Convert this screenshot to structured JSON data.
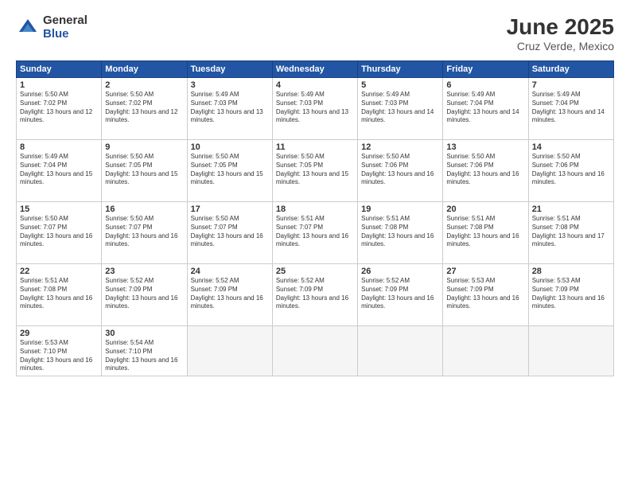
{
  "logo": {
    "general": "General",
    "blue": "Blue"
  },
  "title": "June 2025",
  "location": "Cruz Verde, Mexico",
  "days_of_week": [
    "Sunday",
    "Monday",
    "Tuesday",
    "Wednesday",
    "Thursday",
    "Friday",
    "Saturday"
  ],
  "weeks": [
    [
      {
        "day": 1,
        "sunrise": "5:50 AM",
        "sunset": "7:02 PM",
        "daylight": "13 hours and 12 minutes."
      },
      {
        "day": 2,
        "sunrise": "5:50 AM",
        "sunset": "7:02 PM",
        "daylight": "13 hours and 12 minutes."
      },
      {
        "day": 3,
        "sunrise": "5:49 AM",
        "sunset": "7:03 PM",
        "daylight": "13 hours and 13 minutes."
      },
      {
        "day": 4,
        "sunrise": "5:49 AM",
        "sunset": "7:03 PM",
        "daylight": "13 hours and 13 minutes."
      },
      {
        "day": 5,
        "sunrise": "5:49 AM",
        "sunset": "7:03 PM",
        "daylight": "13 hours and 14 minutes."
      },
      {
        "day": 6,
        "sunrise": "5:49 AM",
        "sunset": "7:04 PM",
        "daylight": "13 hours and 14 minutes."
      },
      {
        "day": 7,
        "sunrise": "5:49 AM",
        "sunset": "7:04 PM",
        "daylight": "13 hours and 14 minutes."
      }
    ],
    [
      {
        "day": 8,
        "sunrise": "5:49 AM",
        "sunset": "7:04 PM",
        "daylight": "13 hours and 15 minutes."
      },
      {
        "day": 9,
        "sunrise": "5:50 AM",
        "sunset": "7:05 PM",
        "daylight": "13 hours and 15 minutes."
      },
      {
        "day": 10,
        "sunrise": "5:50 AM",
        "sunset": "7:05 PM",
        "daylight": "13 hours and 15 minutes."
      },
      {
        "day": 11,
        "sunrise": "5:50 AM",
        "sunset": "7:05 PM",
        "daylight": "13 hours and 15 minutes."
      },
      {
        "day": 12,
        "sunrise": "5:50 AM",
        "sunset": "7:06 PM",
        "daylight": "13 hours and 16 minutes."
      },
      {
        "day": 13,
        "sunrise": "5:50 AM",
        "sunset": "7:06 PM",
        "daylight": "13 hours and 16 minutes."
      },
      {
        "day": 14,
        "sunrise": "5:50 AM",
        "sunset": "7:06 PM",
        "daylight": "13 hours and 16 minutes."
      }
    ],
    [
      {
        "day": 15,
        "sunrise": "5:50 AM",
        "sunset": "7:07 PM",
        "daylight": "13 hours and 16 minutes."
      },
      {
        "day": 16,
        "sunrise": "5:50 AM",
        "sunset": "7:07 PM",
        "daylight": "13 hours and 16 minutes."
      },
      {
        "day": 17,
        "sunrise": "5:50 AM",
        "sunset": "7:07 PM",
        "daylight": "13 hours and 16 minutes."
      },
      {
        "day": 18,
        "sunrise": "5:51 AM",
        "sunset": "7:07 PM",
        "daylight": "13 hours and 16 minutes."
      },
      {
        "day": 19,
        "sunrise": "5:51 AM",
        "sunset": "7:08 PM",
        "daylight": "13 hours and 16 minutes."
      },
      {
        "day": 20,
        "sunrise": "5:51 AM",
        "sunset": "7:08 PM",
        "daylight": "13 hours and 16 minutes."
      },
      {
        "day": 21,
        "sunrise": "5:51 AM",
        "sunset": "7:08 PM",
        "daylight": "13 hours and 17 minutes."
      }
    ],
    [
      {
        "day": 22,
        "sunrise": "5:51 AM",
        "sunset": "7:08 PM",
        "daylight": "13 hours and 16 minutes."
      },
      {
        "day": 23,
        "sunrise": "5:52 AM",
        "sunset": "7:09 PM",
        "daylight": "13 hours and 16 minutes."
      },
      {
        "day": 24,
        "sunrise": "5:52 AM",
        "sunset": "7:09 PM",
        "daylight": "13 hours and 16 minutes."
      },
      {
        "day": 25,
        "sunrise": "5:52 AM",
        "sunset": "7:09 PM",
        "daylight": "13 hours and 16 minutes."
      },
      {
        "day": 26,
        "sunrise": "5:52 AM",
        "sunset": "7:09 PM",
        "daylight": "13 hours and 16 minutes."
      },
      {
        "day": 27,
        "sunrise": "5:53 AM",
        "sunset": "7:09 PM",
        "daylight": "13 hours and 16 minutes."
      },
      {
        "day": 28,
        "sunrise": "5:53 AM",
        "sunset": "7:09 PM",
        "daylight": "13 hours and 16 minutes."
      }
    ],
    [
      {
        "day": 29,
        "sunrise": "5:53 AM",
        "sunset": "7:10 PM",
        "daylight": "13 hours and 16 minutes."
      },
      {
        "day": 30,
        "sunrise": "5:54 AM",
        "sunset": "7:10 PM",
        "daylight": "13 hours and 16 minutes."
      },
      null,
      null,
      null,
      null,
      null
    ]
  ]
}
